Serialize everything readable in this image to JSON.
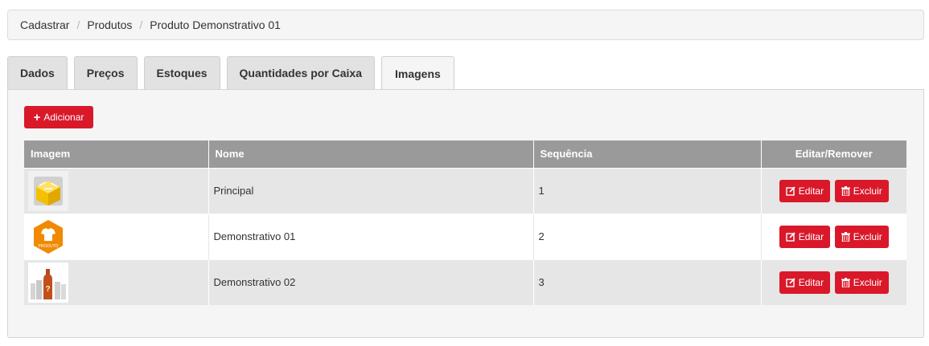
{
  "breadcrumb": {
    "items": [
      "Cadastrar",
      "Produtos",
      "Produto Demonstrativo 01"
    ],
    "separator": "/"
  },
  "tabs": [
    {
      "label": "Dados"
    },
    {
      "label": "Preços"
    },
    {
      "label": "Estoques"
    },
    {
      "label": "Quantidades por Caixa"
    },
    {
      "label": "Imagens",
      "active": true
    }
  ],
  "add_button": {
    "label": "Adicionar",
    "icon": "plus-icon"
  },
  "table": {
    "headers": [
      "Imagem",
      "Nome",
      "Sequência",
      "Editar/Remover"
    ],
    "rows": [
      {
        "image_icon": "box-icon",
        "nome": "Principal",
        "sequencia": "1"
      },
      {
        "image_icon": "produto-badge-icon",
        "nome": "Demonstrativo 01",
        "sequencia": "2"
      },
      {
        "image_icon": "bottle-icon",
        "nome": "Demonstrativo 02",
        "sequencia": "3"
      }
    ],
    "edit_label": "Editar",
    "delete_label": "Excluir",
    "produto_badge_text": "PRODUTO"
  },
  "colors": {
    "accent": "#d9182a",
    "header_bg": "#9a9a9a",
    "badge_orange": "#f08a00"
  }
}
